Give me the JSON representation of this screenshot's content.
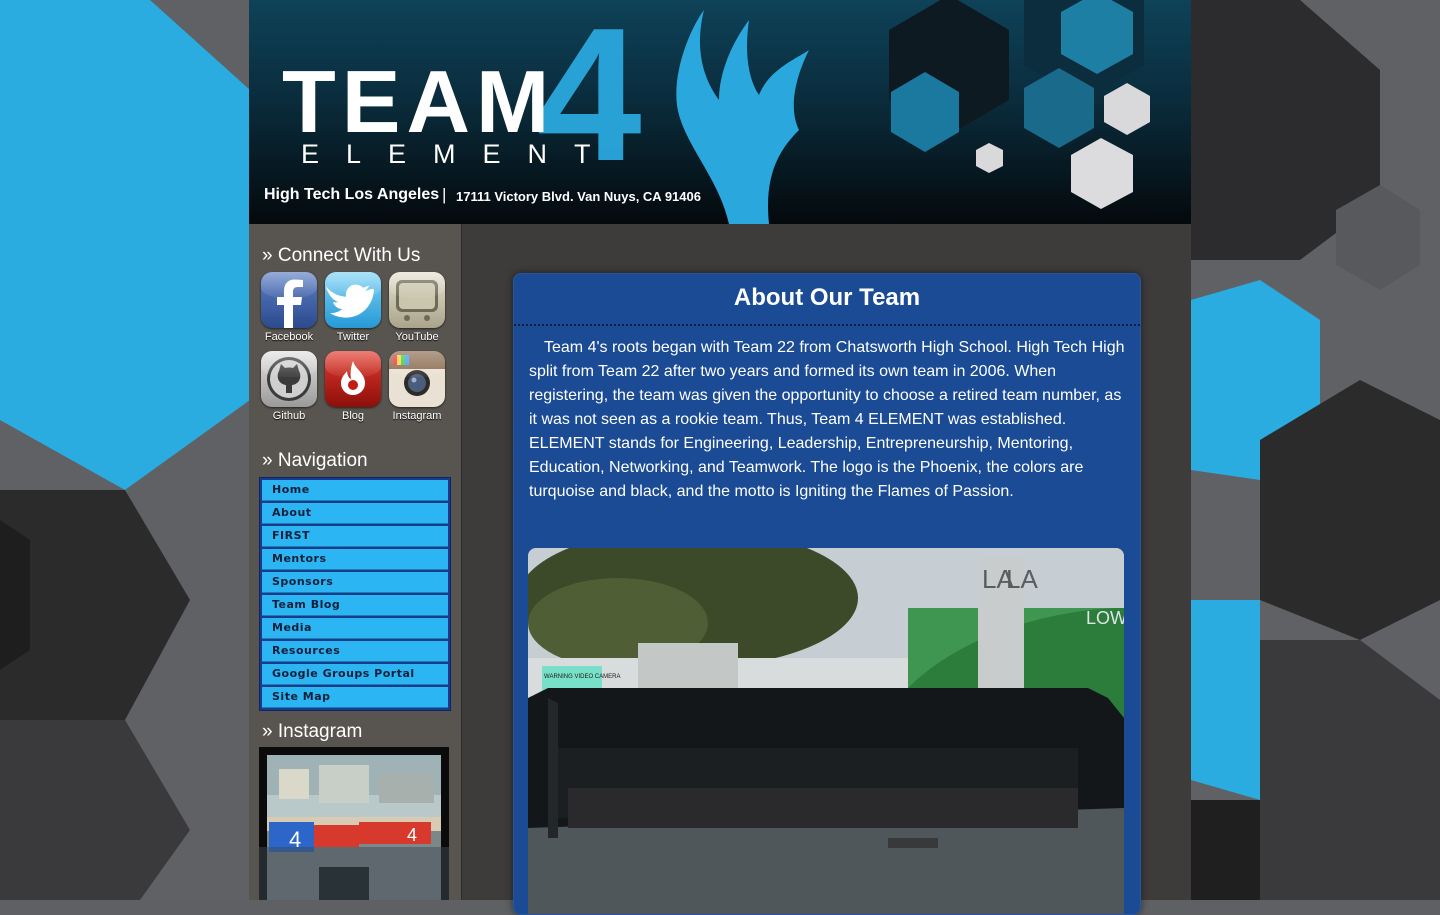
{
  "banner": {
    "logo_main": "TEAM",
    "logo_number": "4",
    "logo_sub": "ELEMENT",
    "school": "High Tech Los Angeles",
    "separator": "|",
    "address": "17111 Victory Blvd. Van Nuys, CA 91406"
  },
  "sidebar": {
    "connect_heading": "» Connect With Us",
    "social": [
      {
        "label": "Facebook",
        "icon": "facebook-icon"
      },
      {
        "label": "Twitter",
        "icon": "twitter-icon"
      },
      {
        "label": "YouTube",
        "icon": "youtube-icon"
      },
      {
        "label": "Github",
        "icon": "github-icon"
      },
      {
        "label": "Blog",
        "icon": "blog-icon"
      },
      {
        "label": "Instagram",
        "icon": "instagram-icon"
      }
    ],
    "navigation_heading": "» Navigation",
    "nav": [
      {
        "label": "Home"
      },
      {
        "label": "About"
      },
      {
        "label": "FIRST"
      },
      {
        "label": "Mentors"
      },
      {
        "label": "Sponsors"
      },
      {
        "label": "Team Blog"
      },
      {
        "label": "Media"
      },
      {
        "label": "Resources"
      },
      {
        "label": "Google Groups Portal"
      },
      {
        "label": "Site Map"
      }
    ],
    "instagram_heading": "» Instagram",
    "instagram_photo_text": [
      "4",
      "4"
    ]
  },
  "main": {
    "title": "About Our Team",
    "body": "Team 4's roots began with Team 22 from Chatsworth High School. High Tech High split from Team 22 after two years and formed its own team in 2006. When registering, the team was given the opportunity to choose a retired team number, as it was not seen as a rookie team. Thus, Team 4 ELEMENT was established. ELEMENT stands for Engineering, Leadership, Entrepreneurship, Mentoring, Education, Networking, and Teamwork. The logo is the Phoenix, the colors are turquoise and black, and the motto is Igniting the Flames of Passion.",
    "photo_signs": [
      "LA",
      "LA",
      "LOW",
      "WARNING VIDEO CAMERA"
    ]
  },
  "colors": {
    "accent": "#2bb5f3",
    "nav_item": "#2bb5f3",
    "content_panel": "#1a4b94",
    "sidebar": "#58544f",
    "wrapper": "#3e3c3b",
    "background_hex_blue": "#2aace0"
  }
}
